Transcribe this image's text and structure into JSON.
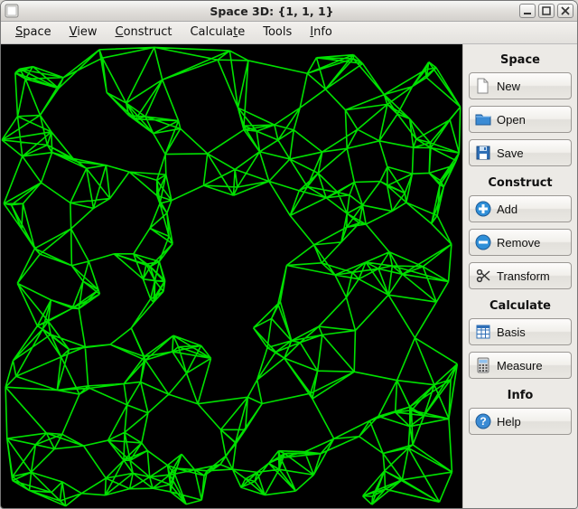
{
  "titlebar": {
    "title": "Space 3D: {1, 1, 1}"
  },
  "menubar": {
    "items": [
      {
        "label": "Space",
        "ul": 0
      },
      {
        "label": "View",
        "ul": 0
      },
      {
        "label": "Construct",
        "ul": 0
      },
      {
        "label": "Calculate",
        "ul": 7
      },
      {
        "label": "Tools",
        "ul": -1
      },
      {
        "label": "Info",
        "ul": 0
      }
    ]
  },
  "sidebar": {
    "sections": [
      {
        "title": "Space",
        "buttons": [
          {
            "name": "new-button",
            "icon": "file-icon",
            "label": "New"
          },
          {
            "name": "open-button",
            "icon": "folder-icon",
            "label": "Open"
          },
          {
            "name": "save-button",
            "icon": "floppy-icon",
            "label": "Save"
          }
        ]
      },
      {
        "title": "Construct",
        "buttons": [
          {
            "name": "add-button",
            "icon": "plus-icon",
            "label": "Add"
          },
          {
            "name": "remove-button",
            "icon": "minus-icon",
            "label": "Remove"
          },
          {
            "name": "transform-button",
            "icon": "scissors-icon",
            "label": "Transform"
          }
        ]
      },
      {
        "title": "Calculate",
        "buttons": [
          {
            "name": "basis-button",
            "icon": "grid-icon",
            "label": "Basis"
          },
          {
            "name": "measure-button",
            "icon": "calculator-icon",
            "label": "Measure"
          }
        ]
      },
      {
        "title": "Info",
        "buttons": [
          {
            "name": "help-button",
            "icon": "help-icon",
            "label": "Help"
          }
        ]
      }
    ]
  },
  "canvas": {
    "line_color": "#00e000",
    "bg_color": "#000000"
  }
}
